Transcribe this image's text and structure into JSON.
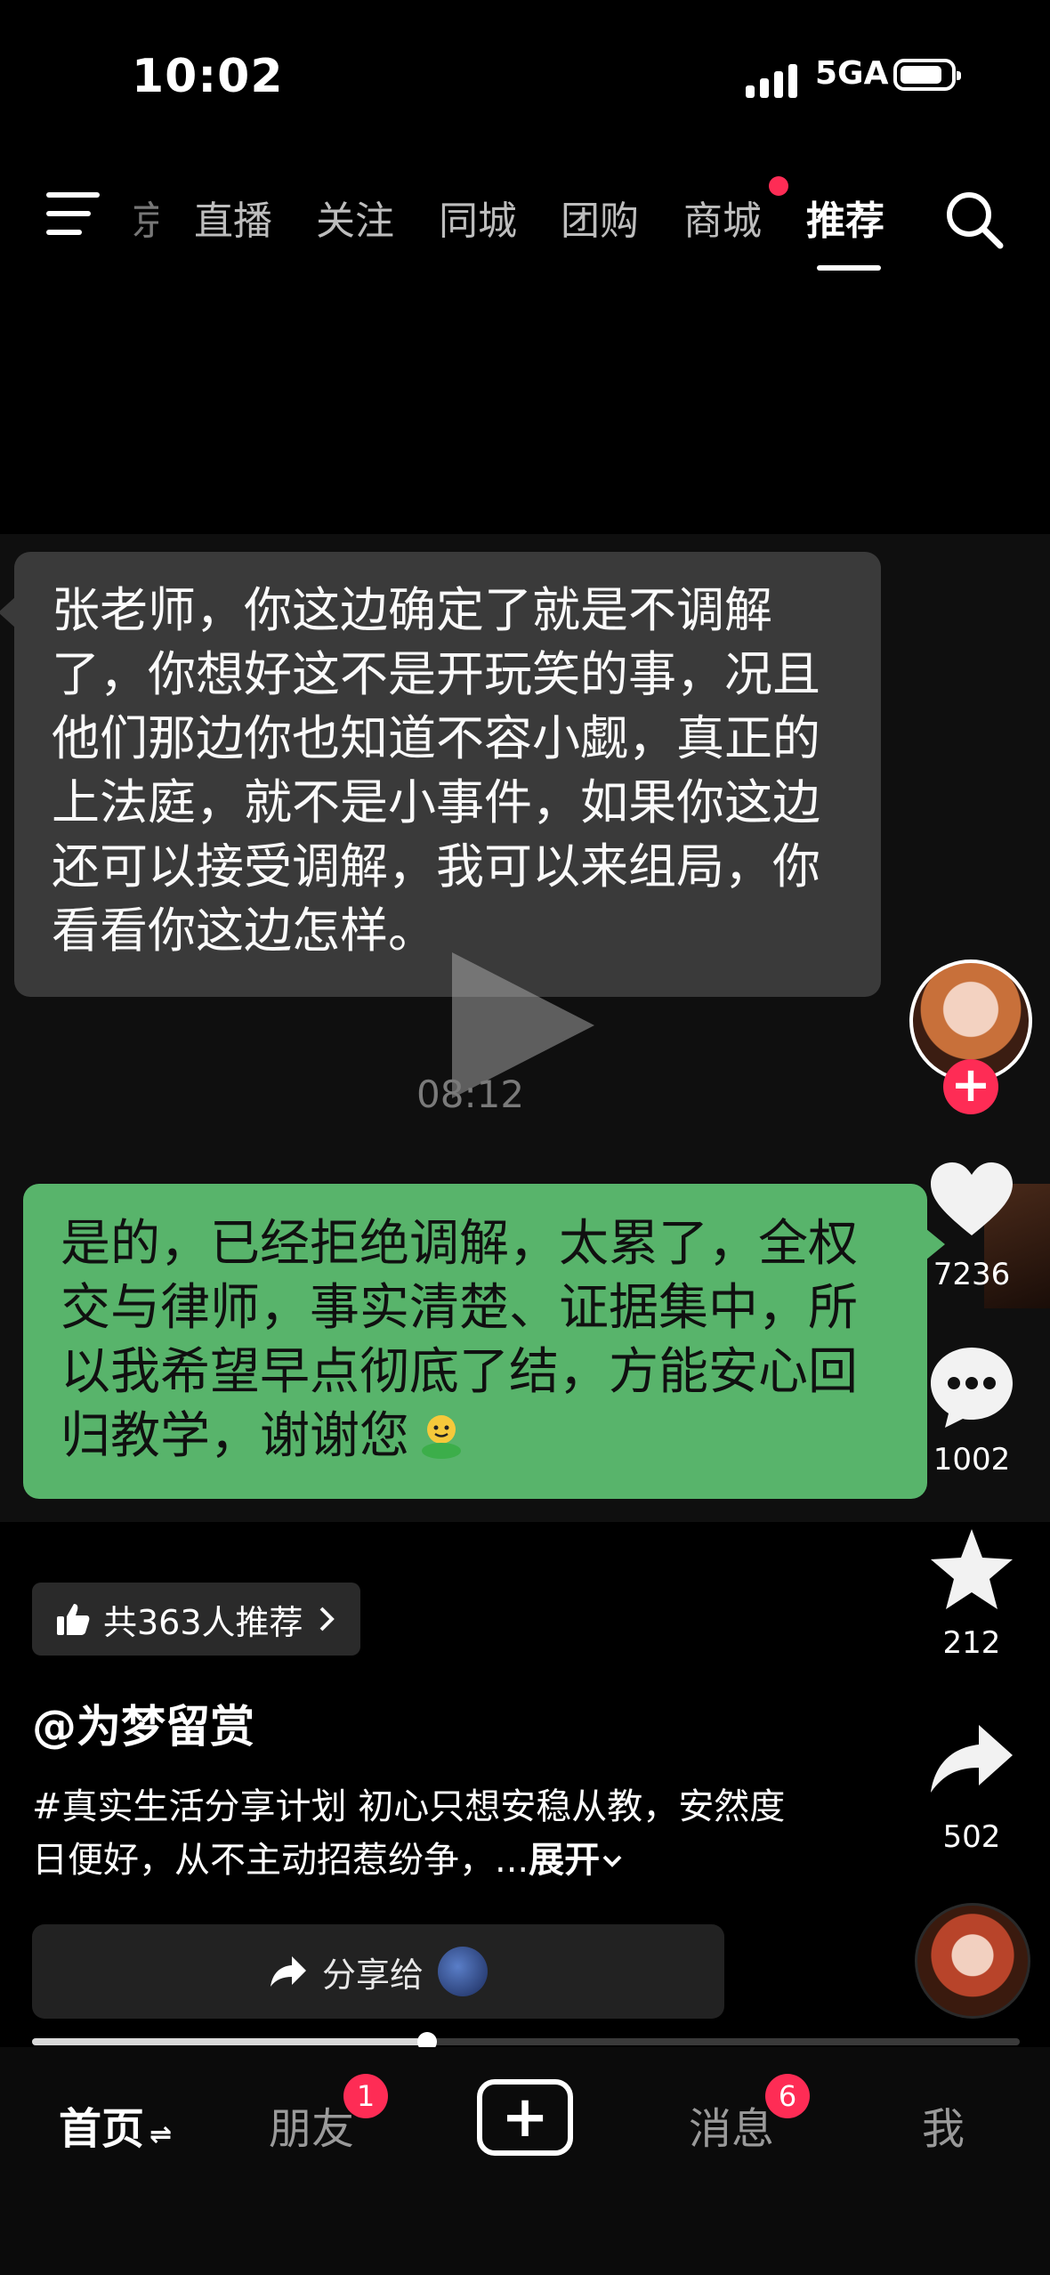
{
  "status_bar": {
    "time": "10:02",
    "network": "5GA"
  },
  "top_nav": {
    "tabs": [
      {
        "label": "直播"
      },
      {
        "label": "关注"
      },
      {
        "label": "同城"
      },
      {
        "label": "团购"
      },
      {
        "label": "商城"
      },
      {
        "label": "推荐",
        "active": true
      }
    ],
    "partial_tab": "京"
  },
  "video": {
    "incoming_message": "张老师，你这边确定了就是不调解了，你想好这不是开玩笑的事，况且他们那边你也知道不容小觑，真正的上法庭，就不是小事件，如果你这边还可以接受调解，我可以来组局，你看看你这边怎样。",
    "outgoing_message": "是的，已经拒绝调解，太累了，全权交与律师，事实清楚、证据集中，所以我希望早点彻底了结，方能安心回归教学，谢谢您",
    "timestamp": "08:12",
    "progress": 0.4
  },
  "actions": {
    "likes": "7236",
    "comments": "1002",
    "favorites": "212",
    "shares": "502"
  },
  "post": {
    "recommend_text": "共363人推荐",
    "author": "@为梦留赏",
    "caption": "#真实生活分享计划 初心只想安稳从教，安然度日便好，从不主动招惹纷争，...",
    "expand_label": "展开",
    "share_label": "分享给"
  },
  "tab_bar": {
    "home": "首页",
    "friends": "朋友",
    "friends_badge": "1",
    "messages": "消息",
    "messages_badge": "6",
    "me": "我"
  },
  "colors": {
    "accent": "#fe2c55",
    "green_bubble": "#58b46b",
    "grey_bubble": "#3a3a3a"
  }
}
